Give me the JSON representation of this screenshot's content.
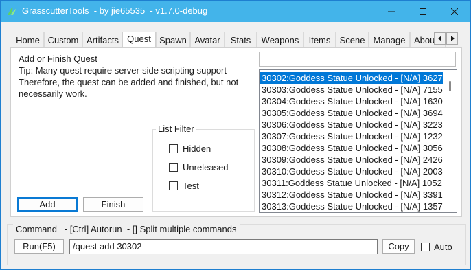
{
  "window": {
    "title": "GrasscutterTools  - by jie65535  - v1.7.0-debug",
    "titlebar_color": "#43b4ea",
    "app_icon": "grasscutter-logo-icon",
    "controls": [
      "minimize-icon",
      "maximize-icon",
      "close-icon"
    ]
  },
  "tabs": [
    {
      "label": "Home"
    },
    {
      "label": "Custom"
    },
    {
      "label": "Artifacts"
    },
    {
      "label": "Quest"
    },
    {
      "label": "Spawn"
    },
    {
      "label": "Avatar"
    },
    {
      "label": "Stats"
    },
    {
      "label": "Weapons"
    },
    {
      "label": "Items"
    },
    {
      "label": "Scene"
    },
    {
      "label": "Manage"
    },
    {
      "label": "About"
    }
  ],
  "active_tab": "Quest",
  "quest": {
    "heading": "Add or Finish Quest",
    "tip_line1": "Tip: Many quest require server-side scripting support",
    "tip_line2": "Therefore, the quest can be added and finished, but not",
    "tip_line3": "necessarily work.",
    "filter": {
      "legend": "List Filter",
      "options": [
        {
          "label": "Hidden",
          "checked": false
        },
        {
          "label": "Unreleased",
          "checked": false
        },
        {
          "label": "Test",
          "checked": false
        }
      ]
    },
    "add_label": "Add",
    "finish_label": "Finish",
    "search_value": "",
    "list": [
      "30302:Goddess Statue Unlocked - [N/A] 3627",
      "30303:Goddess Statue Unlocked - [N/A] 7155",
      "30304:Goddess Statue Unlocked - [N/A] 1630",
      "30305:Goddess Statue Unlocked - [N/A] 3694",
      "30306:Goddess Statue Unlocked - [N/A] 3223",
      "30307:Goddess Statue Unlocked - [N/A] 1232",
      "30308:Goddess Statue Unlocked - [N/A] 3056",
      "30309:Goddess Statue Unlocked - [N/A] 2426",
      "30310:Goddess Statue Unlocked - [N/A] 2003",
      "30311:Goddess Statue Unlocked - [N/A] 1052",
      "30312:Goddess Statue Unlocked - [N/A] 3391",
      "30313:Goddess Statue Unlocked - [N/A] 1357"
    ],
    "selected_index": 0,
    "selection_color": "#0078d7"
  },
  "command": {
    "legend": "Command   - [Ctrl] Autorun  - [] Split multiple commands",
    "run_label": "Run(F5)",
    "value": "/quest add 30302",
    "copy_label": "Copy",
    "auto_label": "Auto",
    "auto_checked": false
  }
}
